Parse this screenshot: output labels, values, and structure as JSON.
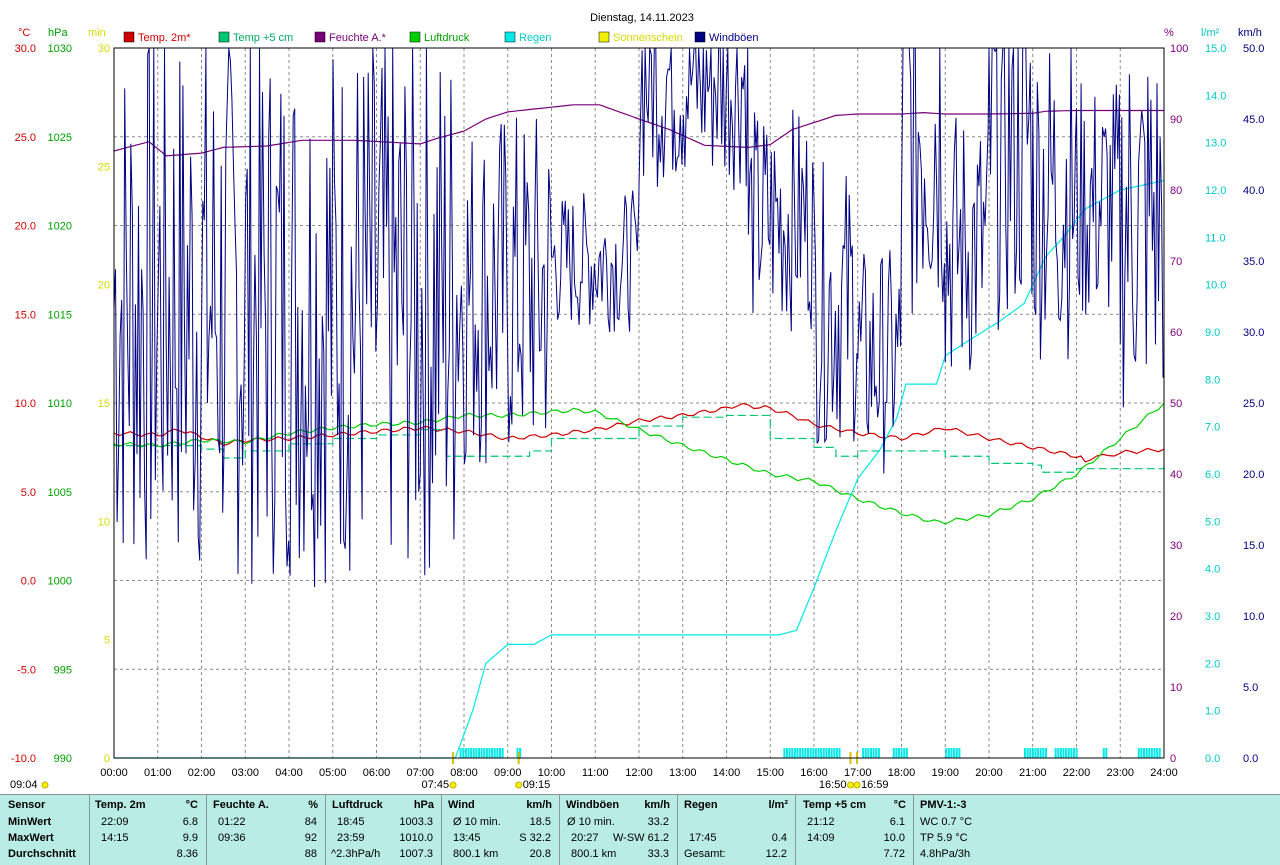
{
  "title": "Dienstag, 14.11.2023",
  "colors": {
    "temp": "#d00000",
    "temp5": "#00c870",
    "humidity": "#780078",
    "pressure": "#00d000",
    "rain": "#00e8e8",
    "sun": "#f0f000",
    "gust": "#000080",
    "grid": "#8c8c8c",
    "axis_purple": "#800080",
    "sun_axis": "#d8d800",
    "stats_bg": "#b8ece4"
  },
  "legend": [
    {
      "label": "Temp. 2m*",
      "color": "#d00000",
      "text_color": "#d00000"
    },
    {
      "label": "Temp +5 cm",
      "color": "#00c870",
      "text_color": "#00a860"
    },
    {
      "label": "Feuchte A.*",
      "color": "#780078",
      "text_color": "#780078"
    },
    {
      "label": "Luftdruck",
      "color": "#00d000",
      "text_color": "#00a000"
    },
    {
      "label": "Regen",
      "color": "#00e8e8",
      "text_color": "#00c8c8"
    },
    {
      "label": "Sonnenschein",
      "color": "#f0f000",
      "text_color": "#d8d800"
    },
    {
      "label": "Windböen",
      "color": "#000080",
      "text_color": "#000080"
    }
  ],
  "axis_units": {
    "temp": "°C",
    "pressure": "hPa",
    "sun": "min",
    "humidity": "%",
    "rain": "l/m²",
    "wind": "km/h"
  },
  "chart_data": {
    "type": "line",
    "x": {
      "min": 0,
      "max": 24,
      "unit": "hour",
      "ticks": [
        "00:00",
        "01:00",
        "02:00",
        "03:00",
        "04:00",
        "05:00",
        "06:00",
        "07:00",
        "08:00",
        "09:00",
        "10:00",
        "11:00",
        "12:00",
        "13:00",
        "14:00",
        "15:00",
        "16:00",
        "17:00",
        "18:00",
        "19:00",
        "20:00",
        "21:00",
        "22:00",
        "23:00",
        "24:00"
      ]
    },
    "axes": {
      "temp": {
        "min": -10,
        "max": 30,
        "ticks": [
          "30.0",
          "25.0",
          "20.0",
          "15.0",
          "10.0",
          "5.0",
          "0.0",
          "-5.0",
          "-10.0"
        ]
      },
      "pressure": {
        "min": 990,
        "max": 1030,
        "ticks": [
          "1030",
          "1025",
          "1020",
          "1015",
          "1010",
          "1005",
          "1000",
          "995",
          "990"
        ]
      },
      "sun": {
        "min": 0,
        "max": 30,
        "ticks": [
          "30",
          "25",
          "20",
          "15",
          "10",
          "5",
          "0"
        ]
      },
      "humidity": {
        "min": 0,
        "max": 100,
        "ticks": [
          "100",
          "90",
          "80",
          "70",
          "60",
          "50",
          "40",
          "30",
          "20",
          "10",
          "0"
        ]
      },
      "rain": {
        "min": 0,
        "max": 15,
        "ticks": [
          "15.0",
          "14.0",
          "13.0",
          "12.0",
          "11.0",
          "10.0",
          "9.0",
          "8.0",
          "7.0",
          "6.0",
          "5.0",
          "4.0",
          "3.0",
          "2.0",
          "1.0",
          "0.0"
        ]
      },
      "wind": {
        "min": 0,
        "max": 50,
        "ticks": [
          "50.0",
          "45.0",
          "40.0",
          "35.0",
          "30.0",
          "25.0",
          "20.0",
          "15.0",
          "10.0",
          "5.0",
          "0.0"
        ]
      }
    },
    "grid": true,
    "series": [
      {
        "name": "Temp. 2m*",
        "axis": "temp",
        "points": [
          [
            0,
            8.3
          ],
          [
            1,
            8.2
          ],
          [
            1.5,
            8.5
          ],
          [
            2,
            8.1
          ],
          [
            2.5,
            7.7
          ],
          [
            3,
            7.9
          ],
          [
            4,
            8.0
          ],
          [
            5,
            8.2
          ],
          [
            6,
            8.4
          ],
          [
            7,
            8.6
          ],
          [
            8,
            8.4
          ],
          [
            9,
            8.0
          ],
          [
            10,
            8.2
          ],
          [
            11,
            8.5
          ],
          [
            12,
            9.0
          ],
          [
            13,
            9.3
          ],
          [
            14,
            9.7
          ],
          [
            14.25,
            9.9
          ],
          [
            15,
            9.7
          ],
          [
            15.5,
            9.3
          ],
          [
            16,
            8.8
          ],
          [
            17,
            8.3
          ],
          [
            18,
            8.0
          ],
          [
            19,
            8.6
          ],
          [
            20,
            8.0
          ],
          [
            21,
            7.5
          ],
          [
            22,
            7.0
          ],
          [
            22.2,
            6.8
          ],
          [
            23,
            7.2
          ],
          [
            24,
            7.4
          ]
        ]
      },
      {
        "name": "Temp +5 cm",
        "axis": "temp",
        "points": [
          [
            0,
            7.6
          ],
          [
            1,
            7.6
          ],
          [
            2,
            7.4
          ],
          [
            2.5,
            6.9
          ],
          [
            3,
            7.3
          ],
          [
            4,
            7.7
          ],
          [
            5,
            8.0
          ],
          [
            6,
            8.2
          ],
          [
            7,
            8.5
          ],
          [
            7.6,
            7.0
          ],
          [
            8.5,
            7.0
          ],
          [
            9.5,
            7.3
          ],
          [
            10,
            8.0
          ],
          [
            12,
            8.7
          ],
          [
            13,
            9.2
          ],
          [
            14,
            9.3
          ],
          [
            15,
            8.0
          ],
          [
            16,
            7.5
          ],
          [
            16.5,
            7.0
          ],
          [
            17,
            7.3
          ],
          [
            18,
            7.3
          ],
          [
            19,
            7.0
          ],
          [
            20,
            6.6
          ],
          [
            21,
            6.5
          ],
          [
            21.2,
            6.1
          ],
          [
            22,
            6.3
          ],
          [
            23,
            6.3
          ],
          [
            24,
            6.5
          ]
        ]
      },
      {
        "name": "Feuchte A.*",
        "axis": "humidity",
        "points": [
          [
            0,
            85.5
          ],
          [
            0.8,
            86.8
          ],
          [
            1.2,
            84.8
          ],
          [
            2,
            85.2
          ],
          [
            2.5,
            86.0
          ],
          [
            3.5,
            86.2
          ],
          [
            4.3,
            87.0
          ],
          [
            5.5,
            87.0
          ],
          [
            7,
            86.5
          ],
          [
            7.4,
            87.3
          ],
          [
            8,
            88.3
          ],
          [
            8.5,
            90.0
          ],
          [
            9,
            91.0
          ],
          [
            9.75,
            91.5
          ],
          [
            10.5,
            92.0
          ],
          [
            11.1,
            92.0
          ],
          [
            12,
            90.0
          ],
          [
            12.7,
            88.5
          ],
          [
            13.5,
            86.3
          ],
          [
            14.5,
            86.0
          ],
          [
            15,
            86.4
          ],
          [
            15.5,
            88.5
          ],
          [
            16,
            89.5
          ],
          [
            16.5,
            90.5
          ],
          [
            17,
            90.7
          ],
          [
            18,
            90.7
          ],
          [
            18.5,
            90.9
          ],
          [
            19,
            90.7
          ],
          [
            20,
            90.7
          ],
          [
            21,
            90.8
          ],
          [
            21.3,
            91.1
          ],
          [
            22,
            91.2
          ],
          [
            23,
            91.2
          ],
          [
            24,
            91.2
          ]
        ]
      },
      {
        "name": "Luftdruck",
        "axis": "pressure",
        "points": [
          [
            0,
            1007.7
          ],
          [
            1,
            1007.6
          ],
          [
            2,
            1007.9
          ],
          [
            3,
            1007.8
          ],
          [
            4,
            1008.3
          ],
          [
            5,
            1008.6
          ],
          [
            6,
            1008.8
          ],
          [
            7,
            1008.9
          ],
          [
            8,
            1009.3
          ],
          [
            9,
            1009.3
          ],
          [
            10,
            1009.5
          ],
          [
            10.5,
            1009.6
          ],
          [
            11,
            1009.5
          ],
          [
            12,
            1008.5
          ],
          [
            13,
            1007.6
          ],
          [
            14,
            1006.8
          ],
          [
            15,
            1006.0
          ],
          [
            16,
            1005.6
          ],
          [
            17,
            1004.6
          ],
          [
            18,
            1003.8
          ],
          [
            18.75,
            1003.3
          ],
          [
            19,
            1003.3
          ],
          [
            20,
            1003.7
          ],
          [
            21,
            1004.6
          ],
          [
            22,
            1006.0
          ],
          [
            23,
            1008.0
          ],
          [
            24,
            1010.0
          ]
        ]
      },
      {
        "name": "Regen",
        "axis": "rain",
        "points": [
          [
            0,
            0
          ],
          [
            7.8,
            0
          ],
          [
            8.2,
            1.0
          ],
          [
            8.5,
            2.0
          ],
          [
            9.0,
            2.4
          ],
          [
            9.6,
            2.4
          ],
          [
            10.0,
            2.6
          ],
          [
            12,
            2.6
          ],
          [
            14,
            2.6
          ],
          [
            15.2,
            2.6
          ],
          [
            15.6,
            2.7
          ],
          [
            16.0,
            3.6
          ],
          [
            16.5,
            4.8
          ],
          [
            17.0,
            5.9
          ],
          [
            17.5,
            6.5
          ],
          [
            17.9,
            7.2
          ],
          [
            18.1,
            7.9
          ],
          [
            18.8,
            7.9
          ],
          [
            19.0,
            8.5
          ],
          [
            19.5,
            8.8
          ],
          [
            20.2,
            9.2
          ],
          [
            20.8,
            9.6
          ],
          [
            21.0,
            10.0
          ],
          [
            21.3,
            10.6
          ],
          [
            21.7,
            11.0
          ],
          [
            22.2,
            11.6
          ],
          [
            22.6,
            11.8
          ],
          [
            23.0,
            12.0
          ],
          [
            23.5,
            12.1
          ],
          [
            24,
            12.2
          ]
        ]
      },
      {
        "name": "Windböen",
        "axis": "wind",
        "ranges": [
          [
            0,
            7.8,
            12,
            52
          ],
          [
            7.8,
            10,
            20,
            46
          ],
          [
            10,
            12,
            30,
            40
          ],
          [
            12,
            14.5,
            40,
            56
          ],
          [
            14.5,
            16,
            30,
            46
          ],
          [
            16,
            17,
            22,
            42
          ],
          [
            17,
            18,
            20,
            36
          ],
          [
            18,
            19,
            30,
            60
          ],
          [
            19,
            20,
            26,
            46
          ],
          [
            20,
            21,
            30,
            58
          ],
          [
            21,
            22,
            28,
            52
          ],
          [
            22,
            23,
            30,
            48
          ],
          [
            23,
            24,
            24,
            52
          ]
        ]
      }
    ],
    "sun_marks": [
      "07:45",
      "09:15",
      "16:50",
      "16:59"
    ],
    "sun_bottom_labels": [
      "09:04"
    ],
    "rain_bars": [
      [
        7.9,
        8.9
      ],
      [
        9.2,
        9.3
      ],
      [
        15.3,
        16.6
      ],
      [
        17.1,
        17.5
      ],
      [
        17.8,
        18.1
      ],
      [
        19.0,
        19.3
      ],
      [
        20.8,
        21.3
      ],
      [
        21.5,
        22.0
      ],
      [
        22.6,
        22.7
      ],
      [
        23.4,
        23.9
      ]
    ]
  },
  "stats": {
    "sensor": {
      "header": "Sensor",
      "rows": [
        "MinWert",
        "MaxWert",
        "Durchschnitt"
      ]
    },
    "temp2m": {
      "header": "Temp. 2m",
      "unit": "°C",
      "rows": [
        [
          "22:09",
          "6.8"
        ],
        [
          "14:15",
          "9.9"
        ],
        [
          "",
          "8.36"
        ]
      ]
    },
    "humidity": {
      "header": "Feuchte A.",
      "unit": "%",
      "rows": [
        [
          "01:22",
          "84"
        ],
        [
          "09:36",
          "92"
        ],
        [
          "",
          "88"
        ]
      ]
    },
    "pressure": {
      "header": "Luftdruck",
      "unit": "hPa",
      "rows": [
        [
          "18:45",
          "1003.3"
        ],
        [
          "23:59",
          "1010.0"
        ],
        [
          "^2.3hPa/h",
          "1007.3"
        ]
      ]
    },
    "wind": {
      "header": "Wind",
      "unit": "km/h",
      "rows": [
        [
          "Ø 10 min.",
          "18.5"
        ],
        [
          "13:45",
          "S 32.2"
        ],
        [
          "800.1 km",
          "20.8"
        ]
      ]
    },
    "gust": {
      "header": "Windböen",
      "unit": "km/h",
      "rows": [
        [
          "Ø 10 min.",
          "33.2"
        ],
        [
          "20:27",
          "W-SW 61.2"
        ],
        [
          "800.1 km",
          "33.3"
        ]
      ]
    },
    "rain": {
      "header": "Regen",
      "unit": "l/m²",
      "rows": [
        [
          "",
          ""
        ],
        [
          "17:45",
          "0.4"
        ],
        [
          "Gesamt:",
          "12.2"
        ]
      ]
    },
    "temp5": {
      "header": "Temp +5 cm",
      "unit": "°C",
      "rows": [
        [
          "21:12",
          "6.1"
        ],
        [
          "14:09",
          "10.0"
        ],
        [
          "",
          "7.72"
        ]
      ]
    },
    "pmv": {
      "header": "PMV-1:-3",
      "rows": [
        "WC 0.7 °C",
        "TP 5.9 °C",
        "4.8hPa/3h"
      ]
    }
  }
}
